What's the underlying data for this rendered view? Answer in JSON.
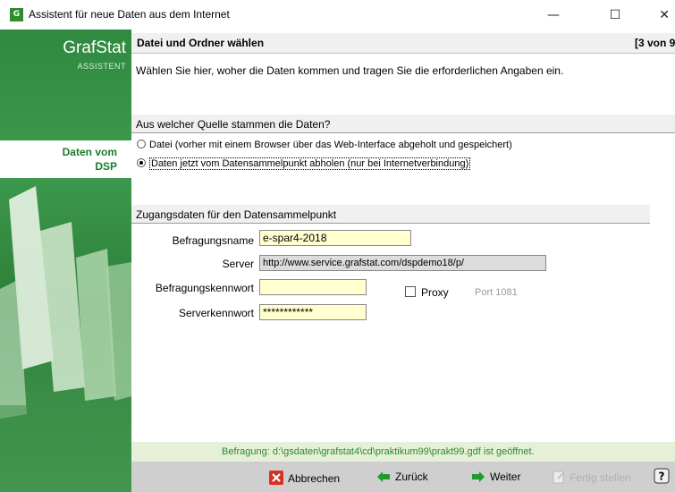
{
  "window": {
    "title": "Assistent für neue Daten aus dem Internet",
    "icon_text": "G",
    "minimize": "—",
    "maximize": "☐",
    "close": "✕"
  },
  "sidebar": {
    "logo": "GrafStat",
    "logo_sub": "ASSISTENT",
    "step_line1": "Daten vom",
    "step_line2": "DSP"
  },
  "header": {
    "title": "Datei und Ordner wählen",
    "step_counter": "[3 von 9"
  },
  "instruction": "Wählen Sie hier, woher die Daten kommen und tragen Sie die erforderlichen Angaben ein.",
  "source_section": {
    "heading": "Aus welcher Quelle stammen die Daten?",
    "options": [
      {
        "label": "Datei   (vorher mit einem Browser über das Web-Interface abgeholt und gespeichert)",
        "selected": false
      },
      {
        "label": "Daten jetzt vom Datensammelpunkt abholen  (nur bei Internetverbindung)",
        "selected": true
      }
    ]
  },
  "access_section": {
    "heading": "Zugangsdaten für den Datensammelpunkt",
    "fields": {
      "survey_name": {
        "label": "Befragungsname",
        "value": "e-spar4-2018"
      },
      "server": {
        "label": "Server",
        "value": "http://www.service.grafstat.com/dspdemo18/p/"
      },
      "survey_password": {
        "label": "Befragungskennwort",
        "value": ""
      },
      "server_password": {
        "label": "Serverkennwort",
        "value": "************"
      }
    },
    "proxy": {
      "label": "Proxy",
      "checked": false
    },
    "port": "Port 1081"
  },
  "status": "Befragung: d:\\gsdaten\\grafstat4\\cd\\praktikum99\\prakt99.gdf ist geöffnet.",
  "buttons": {
    "cancel": "Abbrechen",
    "back": "Zurück",
    "next": "Weiter",
    "finish": "Fertig stellen",
    "help": "?"
  },
  "colors": {
    "brand_green": "#2e8b2e",
    "field_yellow": "#ffffd0",
    "field_gray": "#dcdcdc",
    "status_bg": "#e6efd8"
  }
}
